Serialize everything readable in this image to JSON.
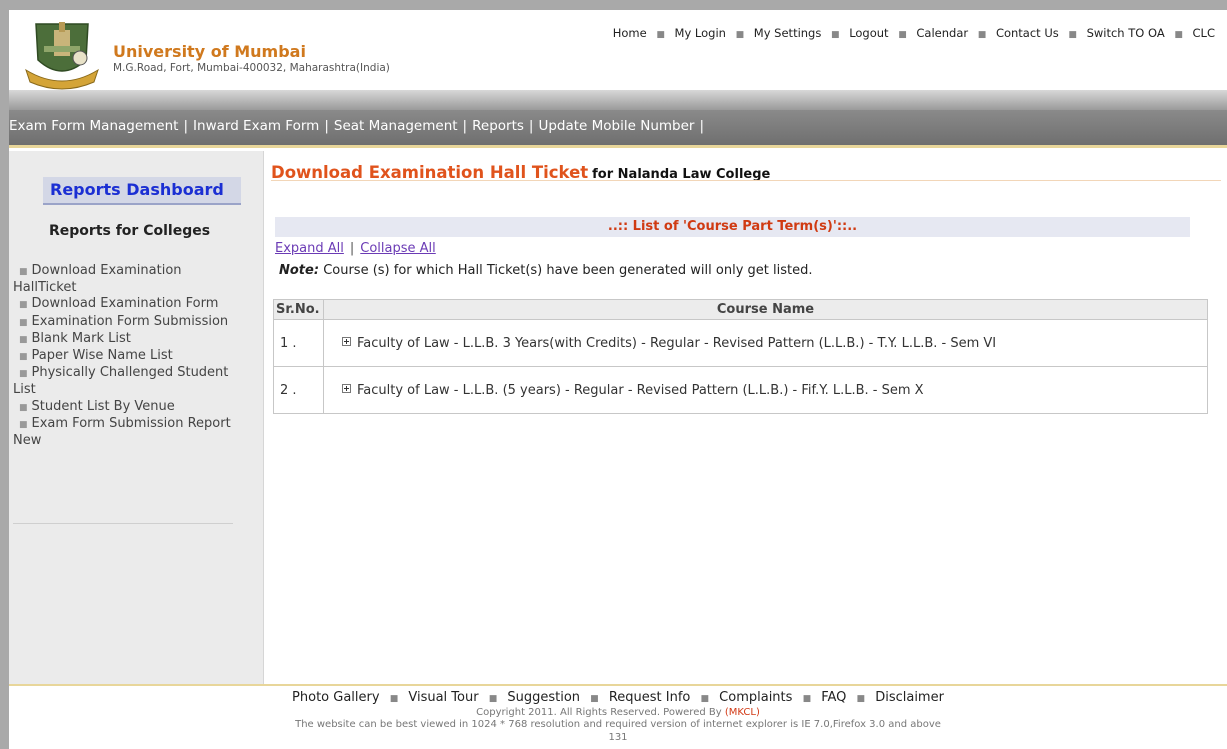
{
  "header": {
    "university_name": "University of Mumbai",
    "address": "M.G.Road, Fort, Mumbai-400032, Maharashtra(India)",
    "top_links": [
      "Home",
      "My Login",
      "My Settings",
      "Logout",
      "Calendar",
      "Contact Us",
      "Switch TO OA",
      "CLC"
    ]
  },
  "navbar": {
    "items": [
      "Exam Form Management",
      "Inward Exam Form",
      "Seat Management",
      "Reports",
      "Update Mobile Number"
    ]
  },
  "sidebar": {
    "dashboard_title": "Reports Dashboard",
    "section_title": "Reports for Colleges",
    "items": [
      "Download Examination HallTicket",
      "Download Examination Form",
      "Examination Form Submission",
      "Blank Mark List",
      "Paper Wise Name List",
      "Physically Challenged Student List",
      "Student List By Venue",
      "Exam Form Submission Report New"
    ]
  },
  "main": {
    "title": "Download Examination Hall Ticket",
    "title_suffix": "for Nalanda Law College",
    "list_header": "..:: List of 'Course Part Term(s)'::..",
    "expand_all": "Expand All",
    "collapse_all": "Collapse All",
    "note_label": "Note:",
    "note_text": "Course (s) for which Hall Ticket(s) have been generated will only get listed.",
    "table": {
      "headers": [
        "Sr.No.",
        "Course Name"
      ],
      "rows": [
        {
          "sr": "1 .",
          "course": "Faculty of Law - L.L.B. 3 Years(with Credits) - Regular - Revised Pattern (L.L.B.) - T.Y. L.L.B. - Sem VI"
        },
        {
          "sr": "2 .",
          "course": "Faculty of Law - L.L.B. (5 years) - Regular - Revised Pattern (L.L.B.) - Fif.Y. L.L.B. - Sem X"
        }
      ]
    }
  },
  "footer": {
    "links": [
      "Photo Gallery",
      "Visual Tour",
      "Suggestion",
      "Request Info",
      "Complaints",
      "FAQ",
      "Disclaimer"
    ],
    "copyright": "Copyright 2011. All Rights Reserved. Powered By",
    "powered_by": "(MKCL)",
    "view_note": "The website can be best viewed in 1024 * 768 resolution and required version of internet explorer is IE 7.0,Firefox 3.0 and above",
    "counter": "131"
  },
  "colors": {
    "brand_orange": "#d0791e",
    "title_orange": "#e0531c",
    "dashboard_blue": "#1b2fd3",
    "nav_gray": "#7a7a7a"
  }
}
